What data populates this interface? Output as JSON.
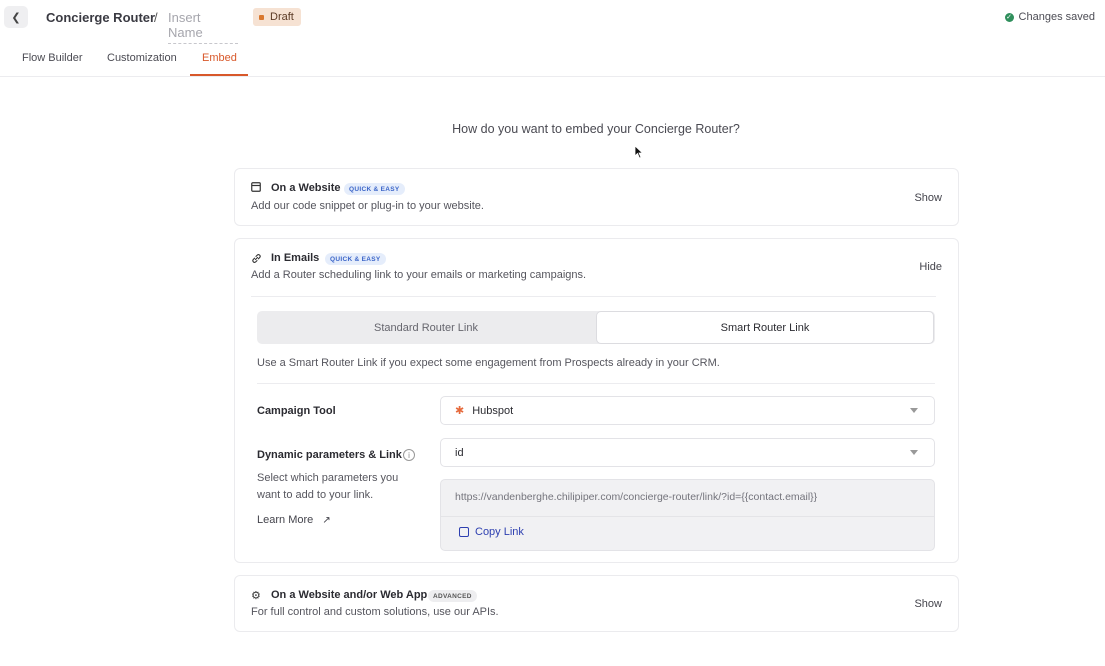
{
  "header": {
    "back_icon": "chevron-left-icon",
    "router_title": "Concierge Router",
    "separator": "/",
    "name_placeholder": "Insert Name",
    "status_badge": "Draft",
    "save_status": "Changes saved"
  },
  "tabs": [
    {
      "label": "Flow Builder",
      "active": false
    },
    {
      "label": "Customization",
      "active": false
    },
    {
      "label": "Embed",
      "active": true
    }
  ],
  "question": "How do you want to embed your Concierge Router?",
  "options": {
    "website": {
      "icon": "browser-window-icon",
      "title": "On a Website",
      "badge": "QUICK & EASY",
      "description": "Add our code snippet or plug-in to your website.",
      "toggle": "Show"
    },
    "emails": {
      "icon": "link-icon",
      "title": "In Emails",
      "badge": "QUICK & EASY",
      "description": "Add a Router scheduling link to your emails or marketing campaigns.",
      "toggle": "Hide",
      "link_types": [
        "Standard Router Link",
        "Smart Router Link"
      ],
      "selected_link_type": "Smart Router Link",
      "hint": "Use a Smart Router Link if you expect some engagement from Prospects already in your CRM.",
      "campaign_tool_label": "Campaign Tool",
      "campaign_tool_value": "Hubspot",
      "dynamic_label": "Dynamic parameters & Link",
      "dynamic_value": "id",
      "dynamic_description": "Select which parameters you want to add to your link.",
      "learn_more": "Learn More",
      "generated_link": "https://vandenberghe.chilipiper.com/concierge-router/link/?id={{contact.email}}",
      "copy_link": "Copy Link"
    },
    "webapp": {
      "icon": "gear-icon",
      "title": "On a Website and/or Web App",
      "badge": "ADVANCED",
      "description": "For full control and custom solutions, use our APIs.",
      "toggle": "Show"
    }
  },
  "colors": {
    "accent": "#d8582a",
    "link": "#2d3fb0",
    "success": "#2f8f5c",
    "draft_bg": "#f6e2d3"
  }
}
